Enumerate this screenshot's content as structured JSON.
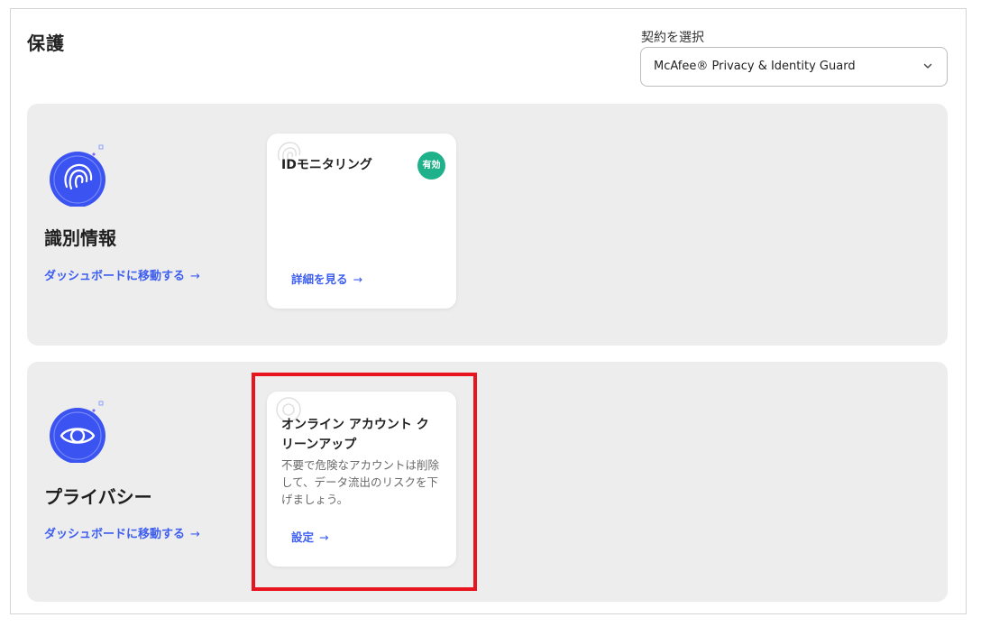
{
  "page": {
    "title": "保護"
  },
  "contract_select": {
    "label": "契約を選択",
    "value": "McAfee® Privacy & Identity Guard",
    "icon": "chevron-down-icon"
  },
  "sections": [
    {
      "title": "識別情報",
      "icon": "fingerprint-icon",
      "dashboard_link": "ダッシュボードに移動する",
      "card": {
        "title": "IDモニタリング",
        "badge": "有効",
        "link": "詳細を見る"
      }
    },
    {
      "title": "プライバシー",
      "icon": "eye-icon",
      "dashboard_link": "ダッシュボードに移動する",
      "card": {
        "title": "オンライン アカウント クリーンアップ",
        "description": "不要で危険なアカウントは削除して、データ流出のリスクを下げましょう。",
        "link": "設定"
      }
    }
  ],
  "colors": {
    "accent": "#3d5ef0",
    "icon_circle": "#3b53f0",
    "badge": "#1fb28a",
    "section_bg": "#ededed",
    "highlight": "#e8141e"
  }
}
